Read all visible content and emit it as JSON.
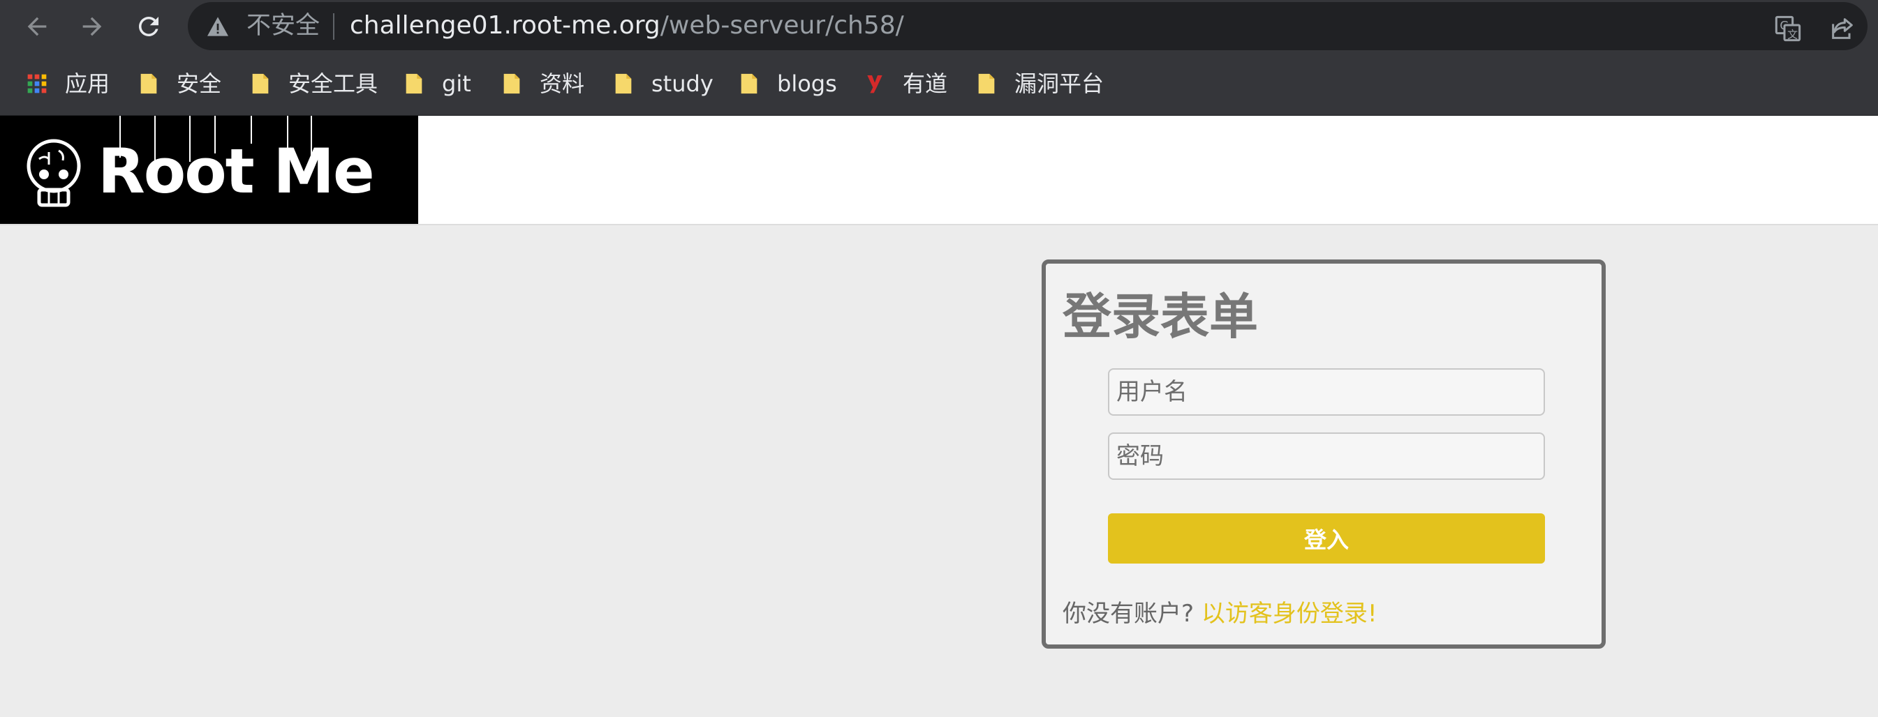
{
  "browser": {
    "security_label": "不安全",
    "url_host": "challenge01.root-me.org",
    "url_path": "/web-serveur/ch58/",
    "bookmarks": [
      {
        "label": "应用",
        "icon": "apps-grid-icon"
      },
      {
        "label": "安全",
        "icon": "folder-icon"
      },
      {
        "label": "安全工具",
        "icon": "folder-icon"
      },
      {
        "label": "git",
        "icon": "folder-icon"
      },
      {
        "label": "资料",
        "icon": "folder-icon"
      },
      {
        "label": "study",
        "icon": "folder-icon"
      },
      {
        "label": "blogs",
        "icon": "folder-icon"
      },
      {
        "label": "有道",
        "icon": "youdao-icon"
      },
      {
        "label": "漏洞平台",
        "icon": "folder-icon"
      }
    ]
  },
  "header": {
    "logo_text": "Root Me"
  },
  "login": {
    "title": "登录表单",
    "username_placeholder": "用户名",
    "password_placeholder": "密码",
    "submit_label": "登入",
    "guest_prefix": "你没有账户?",
    "guest_link": "以访客身份登录!"
  },
  "colors": {
    "chrome_bg": "#35363a",
    "omnibox_bg": "#202124",
    "page_bg": "#ececec",
    "accent_yellow": "#e3c21d",
    "card_border": "#6e6e6e"
  }
}
